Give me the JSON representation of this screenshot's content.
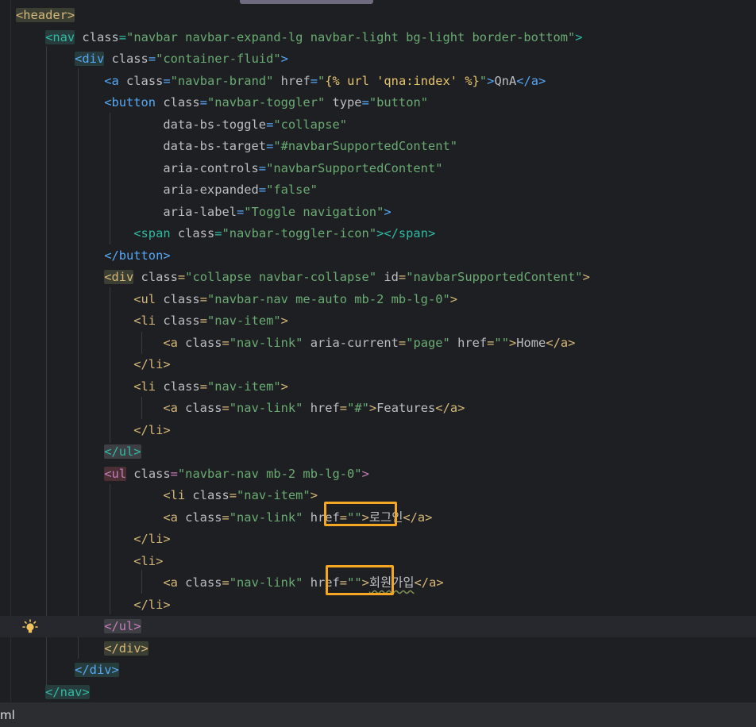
{
  "editor": {
    "lines": [
      {
        "segments": [
          {
            "c": "tag hl-tag",
            "t": "<header>"
          }
        ]
      },
      {
        "segments": [
          {
            "c": "txt",
            "t": "    "
          },
          {
            "c": "tag3 hl-tag-blue",
            "t": "<nav"
          },
          {
            "c": "attr",
            "t": " class"
          },
          {
            "c": "tag3",
            "t": "="
          },
          {
            "c": "str",
            "t": "\"navbar navbar-expand-lg navbar-light bg-light border-bottom\""
          },
          {
            "c": "tag3",
            "t": ">"
          }
        ]
      },
      {
        "segments": [
          {
            "c": "txt",
            "t": "        "
          },
          {
            "c": "tag2 hl-tag-blue",
            "t": "<div"
          },
          {
            "c": "attr",
            "t": " class"
          },
          {
            "c": "tag2",
            "t": "="
          },
          {
            "c": "str",
            "t": "\"container-fluid\""
          },
          {
            "c": "tag2",
            "t": ">"
          }
        ]
      },
      {
        "segments": [
          {
            "c": "txt",
            "t": "            "
          },
          {
            "c": "tag2",
            "t": "<a"
          },
          {
            "c": "attr",
            "t": " class"
          },
          {
            "c": "tag2",
            "t": "="
          },
          {
            "c": "str",
            "t": "\"navbar-brand\""
          },
          {
            "c": "attr",
            "t": " href"
          },
          {
            "c": "tag2",
            "t": "="
          },
          {
            "c": "str",
            "t": "\""
          },
          {
            "c": "tmpl",
            "t": "{% url 'qna:index' %}"
          },
          {
            "c": "str",
            "t": "\""
          },
          {
            "c": "tag2",
            "t": ">"
          },
          {
            "c": "txt",
            "t": "QnA"
          },
          {
            "c": "tag2",
            "t": "</a>"
          }
        ]
      },
      {
        "segments": [
          {
            "c": "txt",
            "t": "            "
          },
          {
            "c": "tag2",
            "t": "<button"
          },
          {
            "c": "attr",
            "t": " class"
          },
          {
            "c": "tag2",
            "t": "="
          },
          {
            "c": "str",
            "t": "\"navbar-toggler\""
          },
          {
            "c": "attr",
            "t": " type"
          },
          {
            "c": "tag2",
            "t": "="
          },
          {
            "c": "str",
            "t": "\"button\""
          }
        ]
      },
      {
        "segments": [
          {
            "c": "txt",
            "t": "                    "
          },
          {
            "c": "attr",
            "t": "data-bs-toggle"
          },
          {
            "c": "tag2",
            "t": "="
          },
          {
            "c": "str",
            "t": "\"collapse\""
          }
        ]
      },
      {
        "segments": [
          {
            "c": "txt",
            "t": "                    "
          },
          {
            "c": "attr",
            "t": "data-bs-target"
          },
          {
            "c": "tag2",
            "t": "="
          },
          {
            "c": "str",
            "t": "\"#navbarSupportedContent\""
          }
        ]
      },
      {
        "segments": [
          {
            "c": "txt",
            "t": "                    "
          },
          {
            "c": "attr",
            "t": "aria-controls"
          },
          {
            "c": "tag2",
            "t": "="
          },
          {
            "c": "str",
            "t": "\"navbarSupportedContent\""
          }
        ]
      },
      {
        "segments": [
          {
            "c": "txt",
            "t": "                    "
          },
          {
            "c": "attr",
            "t": "aria-expanded"
          },
          {
            "c": "tag2",
            "t": "="
          },
          {
            "c": "str",
            "t": "\"false\""
          }
        ]
      },
      {
        "segments": [
          {
            "c": "txt",
            "t": "                    "
          },
          {
            "c": "attr",
            "t": "aria-label"
          },
          {
            "c": "tag2",
            "t": "="
          },
          {
            "c": "str",
            "t": "\"Toggle navigation\""
          },
          {
            "c": "tag2",
            "t": ">"
          }
        ]
      },
      {
        "segments": [
          {
            "c": "txt",
            "t": "                "
          },
          {
            "c": "tag3",
            "t": "<span"
          },
          {
            "c": "attr",
            "t": " class"
          },
          {
            "c": "tag3",
            "t": "="
          },
          {
            "c": "str",
            "t": "\"navbar-toggler-icon\""
          },
          {
            "c": "tag3",
            "t": "></span>"
          }
        ]
      },
      {
        "segments": [
          {
            "c": "txt",
            "t": "            "
          },
          {
            "c": "tag2",
            "t": "</button>"
          }
        ]
      },
      {
        "segments": [
          {
            "c": "txt",
            "t": "            "
          },
          {
            "c": "tag hl-tag",
            "t": "<div"
          },
          {
            "c": "attr",
            "t": " class"
          },
          {
            "c": "tag",
            "t": "="
          },
          {
            "c": "str",
            "t": "\"collapse navbar-collapse\""
          },
          {
            "c": "attr",
            "t": " id"
          },
          {
            "c": "tag",
            "t": "="
          },
          {
            "c": "str",
            "t": "\"navbarSupportedContent\""
          },
          {
            "c": "tag",
            "t": ">"
          }
        ]
      },
      {
        "segments": [
          {
            "c": "txt",
            "t": "                "
          },
          {
            "c": "tag",
            "t": "<ul"
          },
          {
            "c": "attr",
            "t": " class"
          },
          {
            "c": "tag",
            "t": "="
          },
          {
            "c": "str",
            "t": "\"navbar-nav me-auto mb-2 mb-lg-0\""
          },
          {
            "c": "tag",
            "t": ">"
          }
        ]
      },
      {
        "segments": [
          {
            "c": "txt",
            "t": "                "
          },
          {
            "c": "tag",
            "t": "<li"
          },
          {
            "c": "attr",
            "t": " class"
          },
          {
            "c": "tag",
            "t": "="
          },
          {
            "c": "str",
            "t": "\"nav-item\""
          },
          {
            "c": "tag",
            "t": ">"
          }
        ]
      },
      {
        "segments": [
          {
            "c": "txt",
            "t": "                    "
          },
          {
            "c": "tag",
            "t": "<a"
          },
          {
            "c": "attr",
            "t": " class"
          },
          {
            "c": "tag",
            "t": "="
          },
          {
            "c": "str",
            "t": "\"nav-link\""
          },
          {
            "c": "attr",
            "t": " aria-current"
          },
          {
            "c": "tag",
            "t": "="
          },
          {
            "c": "str",
            "t": "\"page\""
          },
          {
            "c": "attr",
            "t": " href"
          },
          {
            "c": "tag",
            "t": "="
          },
          {
            "c": "str",
            "t": "\"\""
          },
          {
            "c": "tag",
            "t": ">"
          },
          {
            "c": "txt",
            "t": "Home"
          },
          {
            "c": "tag",
            "t": "</a>"
          }
        ]
      },
      {
        "segments": [
          {
            "c": "txt",
            "t": "                "
          },
          {
            "c": "tag",
            "t": "</li>"
          }
        ]
      },
      {
        "segments": [
          {
            "c": "txt",
            "t": "                "
          },
          {
            "c": "tag",
            "t": "<li"
          },
          {
            "c": "attr",
            "t": " class"
          },
          {
            "c": "tag",
            "t": "="
          },
          {
            "c": "str",
            "t": "\"nav-item\""
          },
          {
            "c": "tag",
            "t": ">"
          }
        ]
      },
      {
        "segments": [
          {
            "c": "txt",
            "t": "                    "
          },
          {
            "c": "tag",
            "t": "<a"
          },
          {
            "c": "attr",
            "t": " class"
          },
          {
            "c": "tag",
            "t": "="
          },
          {
            "c": "str",
            "t": "\"nav-link\""
          },
          {
            "c": "attr",
            "t": " href"
          },
          {
            "c": "tag",
            "t": "="
          },
          {
            "c": "str",
            "t": "\"#\""
          },
          {
            "c": "tag",
            "t": ">"
          },
          {
            "c": "txt",
            "t": "Features"
          },
          {
            "c": "tag",
            "t": "</a>"
          }
        ]
      },
      {
        "segments": [
          {
            "c": "txt",
            "t": "                "
          },
          {
            "c": "tag",
            "t": "</li>"
          }
        ]
      },
      {
        "segments": [
          {
            "c": "txt",
            "t": "            "
          },
          {
            "c": "tag3 hl-tag-gray",
            "t": "</ul>"
          }
        ]
      },
      {
        "segments": [
          {
            "c": "txt",
            "t": "            "
          },
          {
            "c": "tag4 hl-tag-red",
            "t": "<ul"
          },
          {
            "c": "attr",
            "t": " class"
          },
          {
            "c": "tag4",
            "t": "="
          },
          {
            "c": "str",
            "t": "\"navbar-nav mb-2 mb-lg-0\""
          },
          {
            "c": "tag4",
            "t": ">"
          }
        ]
      },
      {
        "segments": [
          {
            "c": "txt",
            "t": "                    "
          },
          {
            "c": "tag",
            "t": "<li"
          },
          {
            "c": "attr",
            "t": " class"
          },
          {
            "c": "tag",
            "t": "="
          },
          {
            "c": "str",
            "t": "\"nav-item\""
          },
          {
            "c": "tag",
            "t": ">"
          }
        ]
      },
      {
        "segments": [
          {
            "c": "txt",
            "t": "                    "
          },
          {
            "c": "tag",
            "t": "<a"
          },
          {
            "c": "attr",
            "t": " class"
          },
          {
            "c": "tag",
            "t": "="
          },
          {
            "c": "str",
            "t": "\"nav-link\""
          },
          {
            "c": "attr",
            "t": " href"
          },
          {
            "c": "tag",
            "t": "="
          },
          {
            "c": "str",
            "t": "\"\""
          },
          {
            "c": "tag",
            "t": ">"
          },
          {
            "c": "txt",
            "t": "로그인"
          },
          {
            "c": "tag",
            "t": "</a>"
          }
        ]
      },
      {
        "segments": [
          {
            "c": "txt",
            "t": "                "
          },
          {
            "c": "tag",
            "t": "</li>"
          }
        ]
      },
      {
        "segments": [
          {
            "c": "txt",
            "t": "                "
          },
          {
            "c": "tag",
            "t": "<li>"
          }
        ]
      },
      {
        "segments": [
          {
            "c": "txt",
            "t": "                    "
          },
          {
            "c": "tag",
            "t": "<a"
          },
          {
            "c": "attr",
            "t": " class"
          },
          {
            "c": "tag",
            "t": "="
          },
          {
            "c": "str",
            "t": "\"nav-link\""
          },
          {
            "c": "attr",
            "t": " href"
          },
          {
            "c": "tag",
            "t": "="
          },
          {
            "c": "str",
            "t": "\"\""
          },
          {
            "c": "tag",
            "t": ">"
          },
          {
            "c": "txt squiggle",
            "t": "회원가입"
          },
          {
            "c": "tag",
            "t": "</a>"
          }
        ]
      },
      {
        "segments": [
          {
            "c": "txt",
            "t": "                "
          },
          {
            "c": "tag",
            "t": "</li>"
          }
        ]
      },
      {
        "segments": [
          {
            "c": "txt",
            "t": "            "
          },
          {
            "c": "tag4 hl-tag-gray",
            "t": "</ul>"
          }
        ]
      },
      {
        "segments": [
          {
            "c": "txt",
            "t": "            "
          },
          {
            "c": "tag hl-tag",
            "t": "</div>"
          }
        ]
      },
      {
        "segments": [
          {
            "c": "txt",
            "t": "        "
          },
          {
            "c": "tag2 hl-tag-blue",
            "t": "</div>"
          }
        ]
      },
      {
        "segments": [
          {
            "c": "txt",
            "t": "    "
          },
          {
            "c": "tag3 hl-tag-blue",
            "t": "</nav>"
          }
        ]
      }
    ]
  },
  "status_bar": {
    "file_type": "ml"
  },
  "colors": {
    "background": "#1e1f22",
    "highlight_box": "#f5a623",
    "bulb": "#f2c55c"
  }
}
